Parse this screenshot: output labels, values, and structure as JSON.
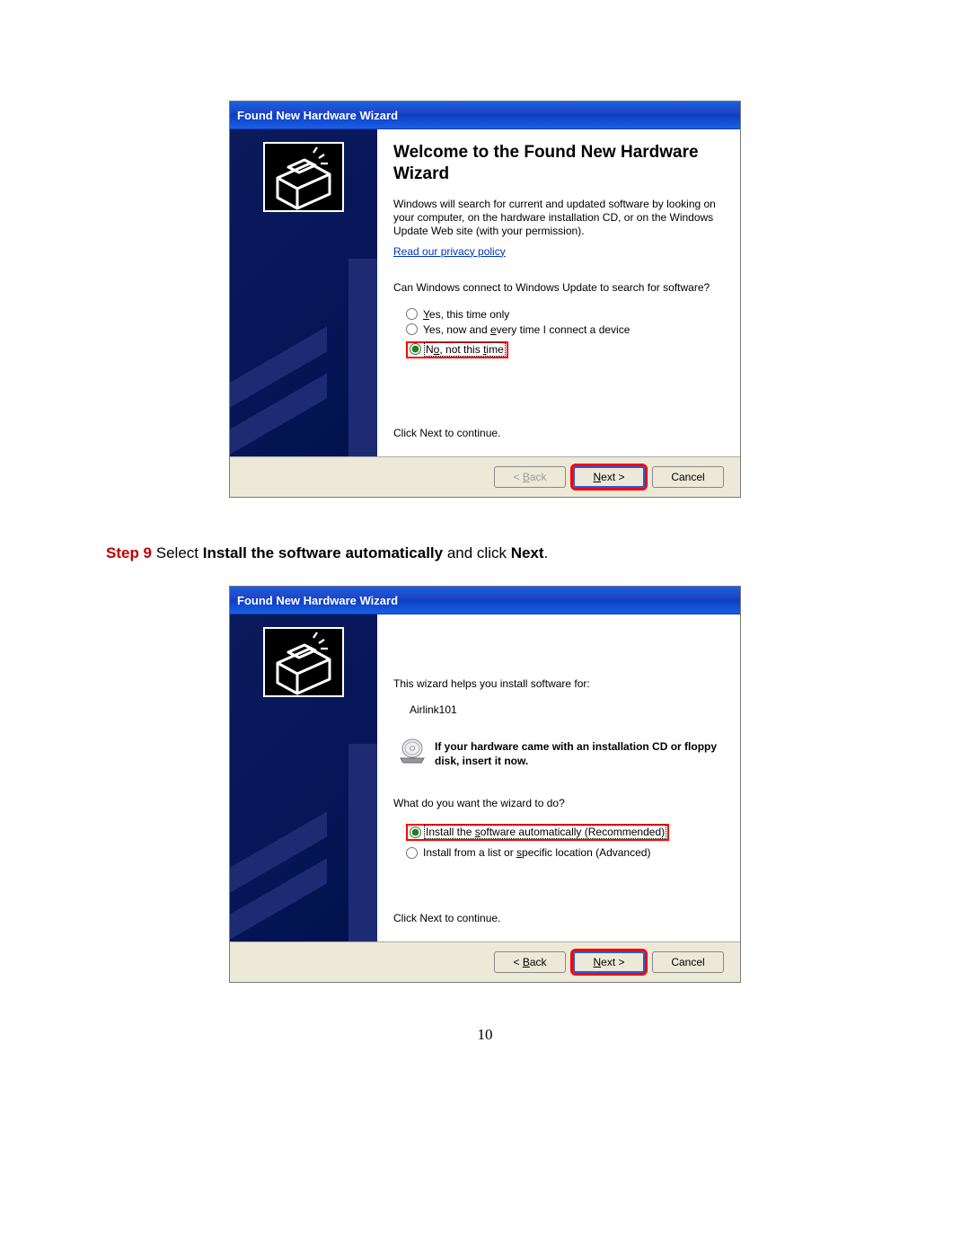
{
  "page_number": "10",
  "step": {
    "label": "Step 9",
    "text1": "Select ",
    "bold1": "Install the software automatically",
    "text2": " and click ",
    "bold2": "Next",
    "text3": "."
  },
  "wiz1": {
    "title": "Found New Hardware Wizard",
    "heading": "Welcome to the Found New Hardware Wizard",
    "para1": "Windows will search for current and updated software by looking on your computer, on the hardware installation CD, or on the Windows Update Web site (with your permission).",
    "link": "Read our privacy policy",
    "question": "Can Windows connect to Windows Update to search for software?",
    "opt1": "Yes, this time only",
    "opt2": "Yes, now and every time I connect a device",
    "opt3": "No, not this time",
    "continue": "Click Next to continue.",
    "back": "< Back",
    "next": "Next >",
    "cancel": "Cancel"
  },
  "wiz2": {
    "title": "Found New Hardware Wizard",
    "para1": "This wizard helps you install software for:",
    "device": "Airlink101",
    "cd_text": "If your hardware came with an installation CD or floppy disk, insert it now.",
    "question": "What do you want the wizard to do?",
    "opt1": "Install the software automatically (Recommended)",
    "opt2": "Install from a list or specific location (Advanced)",
    "continue": "Click Next to continue.",
    "back": "< Back",
    "next": "Next >",
    "cancel": "Cancel"
  }
}
